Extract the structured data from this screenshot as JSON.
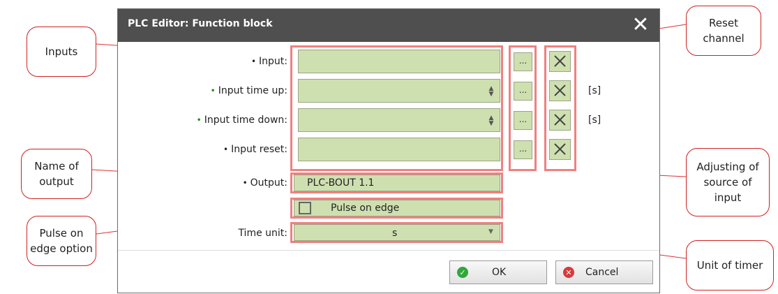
{
  "dialog": {
    "title": "PLC Editor: Function block",
    "close_glyph": "✕",
    "rows": [
      {
        "label": "Input:",
        "dot": "•"
      },
      {
        "label": "Input time up:",
        "dot": "•",
        "unit": "[s]"
      },
      {
        "label": "Input time down:",
        "dot": "•",
        "unit": "[s]"
      },
      {
        "label": "Input reset:",
        "dot": "•"
      },
      {
        "label": "Output:",
        "dot": "•",
        "value": "PLC-BOUT 1.1"
      }
    ],
    "dots_label": "...",
    "pulse_label": "Pulse on edge",
    "time_unit_label": "Time unit:",
    "time_unit_value": "s",
    "ok_label": "OK",
    "cancel_label": "Cancel",
    "colors": {
      "field": "#cfe0b0",
      "highlight": "#f08080",
      "dot_green": "#1a8a1a",
      "ok": "#2fa83a",
      "cancel": "#d83a3a"
    }
  },
  "callouts": {
    "inputs": "Inputs",
    "name_output": "Name of output",
    "pulse_option": "Pulse on edge option",
    "reset_channel": "Reset channel",
    "adjusting": "Adjusting of source of input",
    "unit_timer": "Unit of timer"
  }
}
